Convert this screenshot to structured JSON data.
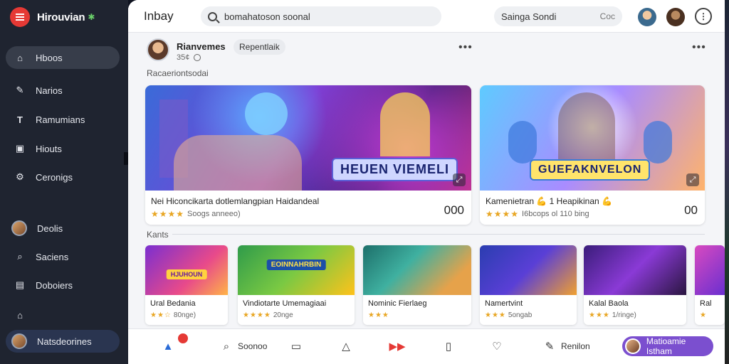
{
  "brand": {
    "name": "Hirouvian",
    "menu_icon": "hamburger-icon"
  },
  "sidebar": {
    "items": [
      {
        "label": "Hboos",
        "icon": "home-icon"
      },
      {
        "label": "Narios",
        "icon": "edit-icon"
      },
      {
        "label": "Ramumians",
        "icon": "text-icon"
      },
      {
        "label": "Hiouts",
        "icon": "image-icon"
      },
      {
        "label": "Ceronigs",
        "icon": "settings-icon"
      },
      {
        "label": "Deolis",
        "icon": "avatar"
      },
      {
        "label": "Saciens",
        "icon": "search-icon"
      },
      {
        "label": "Doboiers",
        "icon": "book-icon"
      },
      {
        "label": "",
        "icon": "house-icon"
      },
      {
        "label": "Natsdeorines",
        "icon": "avatar"
      }
    ]
  },
  "topbar": {
    "title": "Inbay",
    "search_value": "bomahatoson soonal",
    "setting_label": "Sainga Sondi",
    "setting_small": "Coc",
    "help_icon": "more-icon"
  },
  "post": {
    "author": "Rianvemes",
    "chip": "Repentlaik",
    "time": "35¢",
    "section1": "Racaeriontsodai",
    "section2": "Kants"
  },
  "big_cards": [
    {
      "banner": "HEUEN VIEMELI",
      "title": "Nei Hiconcikarta dotlemlangpian Haidandeal",
      "sub": "Soogs anneeo)",
      "count": "000"
    },
    {
      "banner": "GUEFAKNVELON",
      "title": "Kamenietran 💪 1 Heapikinan 💪",
      "sub": "I6bcops ol 110 bing",
      "count": "00"
    }
  ],
  "small_cards": [
    {
      "banner": "HJUHOUN",
      "title": "Ural Bedania",
      "sub": "80nge)"
    },
    {
      "banner": "EOINNAHRBIN",
      "title": "Vindiotarte Umemagiaai",
      "sub": "20nge"
    },
    {
      "banner": "",
      "title": "Nominic Fierlaeg",
      "sub": ""
    },
    {
      "banner": "",
      "title": "Namertvint",
      "sub": "5ongab"
    },
    {
      "banner": "",
      "title": "Kalal Baola",
      "sub": "1/ringe)"
    },
    {
      "banner": "",
      "title": "Ral",
      "sub": ""
    }
  ],
  "bottom_nav": {
    "items": [
      {
        "label": "",
        "icon": "thumbs-up-icon"
      },
      {
        "label": "Soonoo",
        "icon": "search-icon"
      },
      {
        "label": "",
        "icon": "message-icon"
      },
      {
        "label": "",
        "icon": "thumbs-up-outline-icon"
      },
      {
        "label": "",
        "icon": "fast-forward-icon"
      },
      {
        "label": "",
        "icon": "book-open-icon"
      },
      {
        "label": "",
        "icon": "heart-icon"
      },
      {
        "label": "Renilon",
        "icon": "pencil-icon"
      }
    ],
    "user_label": "Matioamie Istham"
  },
  "colors": {
    "accent": "#e53935",
    "user_pill": "#7b4fcf",
    "sidebar": "#1f2430",
    "star": "#e8a623"
  }
}
